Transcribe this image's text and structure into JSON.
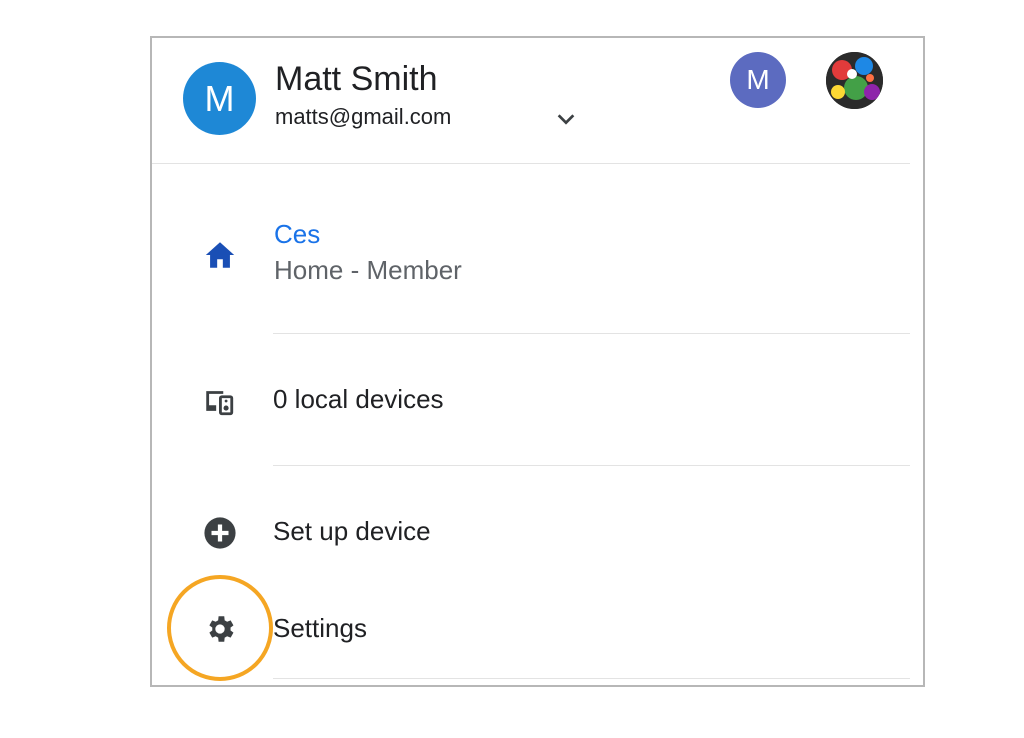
{
  "account": {
    "avatar_letter": "M",
    "name": "Matt Smith",
    "email": "matts@gmail.com",
    "chevron_icon": "chevron-down-icon",
    "other_avatar_letter": "M",
    "photo_avatar_icon": "profile-photo-avatar"
  },
  "home": {
    "name": "Ces",
    "role": "Home - Member",
    "icon": "home-icon",
    "name_color": "#1a73e8"
  },
  "menu": {
    "local_devices_label": "0 local devices",
    "local_devices_icon": "devices-icon",
    "setup_label": "Set up device",
    "setup_icon": "add-circle-icon",
    "settings_label": "Settings",
    "settings_icon": "gear-icon"
  },
  "colors": {
    "main_avatar": "#1e88d6",
    "secondary_avatar": "#5c6bc0",
    "highlight": "#f5a623"
  }
}
